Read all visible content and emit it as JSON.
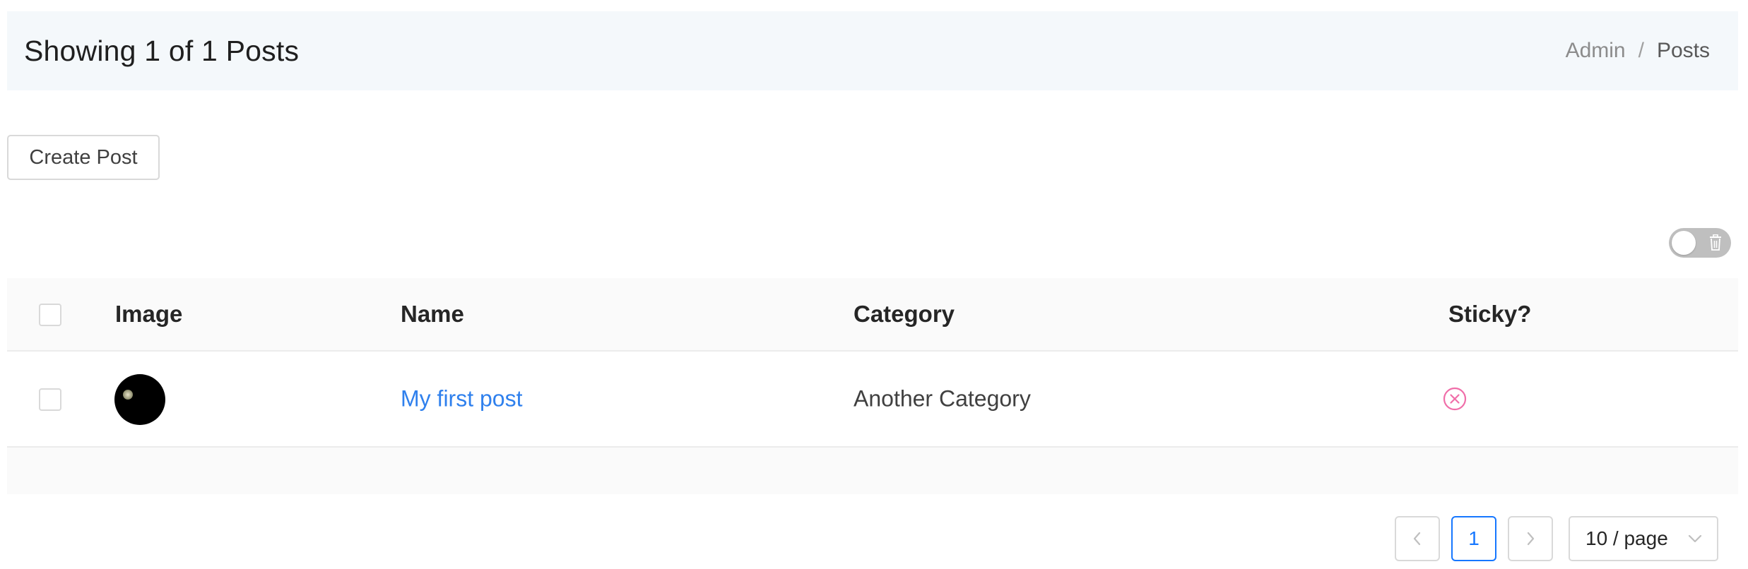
{
  "header": {
    "title": "Showing 1 of 1 Posts",
    "breadcrumb": [
      "Admin",
      "Posts"
    ],
    "breadcrumb_separator": "/"
  },
  "actions": {
    "create_label": "Create Post"
  },
  "trash_toggle": {
    "on": false,
    "icon": "trash-icon"
  },
  "table": {
    "columns": [
      "Image",
      "Name",
      "Category",
      "Sticky?"
    ],
    "rows": [
      {
        "name": "My first post",
        "category": "Another Category",
        "sticky": false,
        "sticky_icon": "close-circle-icon"
      }
    ]
  },
  "pagination": {
    "prev_icon": "chevron-left-icon",
    "next_icon": "chevron-right-icon",
    "current_page": "1",
    "page_size": "10 / page"
  },
  "colors": {
    "header_bg": "#f4f8fb",
    "link": "#2f80ed",
    "active_page": "#1677ff",
    "sticky_false": "#f06ea9"
  }
}
